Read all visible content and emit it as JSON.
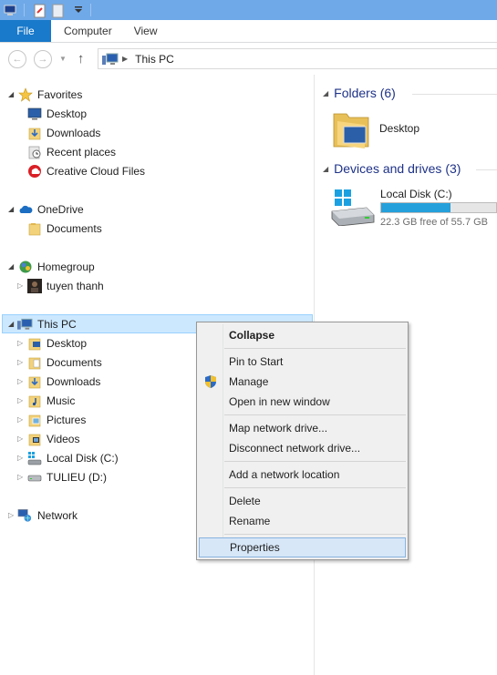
{
  "ribbon": {
    "file_tab": "File",
    "tabs": [
      "Computer",
      "View"
    ]
  },
  "address": {
    "path": "This PC"
  },
  "navpane": {
    "favorites": {
      "label": "Favorites",
      "items": [
        "Desktop",
        "Downloads",
        "Recent places",
        "Creative Cloud Files"
      ]
    },
    "onedrive": {
      "label": "OneDrive",
      "items": [
        "Documents"
      ]
    },
    "homegroup": {
      "label": "Homegroup",
      "items": [
        "tuyen thanh"
      ]
    },
    "thispc": {
      "label": "This PC",
      "items": [
        "Desktop",
        "Documents",
        "Downloads",
        "Music",
        "Pictures",
        "Videos",
        "Local Disk (C:)",
        "TULIEU (D:)"
      ]
    },
    "network": {
      "label": "Network"
    }
  },
  "content": {
    "folders_header": "Folders (6)",
    "folder_item": "Desktop",
    "drives_header": "Devices and drives (3)",
    "drive": {
      "name": "Local Disk (C:)",
      "free_text": "22.3 GB free of 55.7 GB",
      "used_fraction": 0.6
    }
  },
  "context_menu": {
    "items": [
      {
        "label": "Collapse"
      },
      {
        "label": "Pin to Start"
      },
      {
        "label": "Manage"
      },
      {
        "label": "Open in new window"
      },
      {
        "label": "Map network drive..."
      },
      {
        "label": "Disconnect network drive..."
      },
      {
        "label": "Add a network location"
      },
      {
        "label": "Delete"
      },
      {
        "label": "Rename"
      },
      {
        "label": "Properties"
      }
    ]
  },
  "colors": {
    "titlebar": "#6fa9e8",
    "file_tab": "#1979ca",
    "selection": "#cce8ff",
    "group_header": "#1e3287",
    "drive_bar": "#26a0da"
  }
}
